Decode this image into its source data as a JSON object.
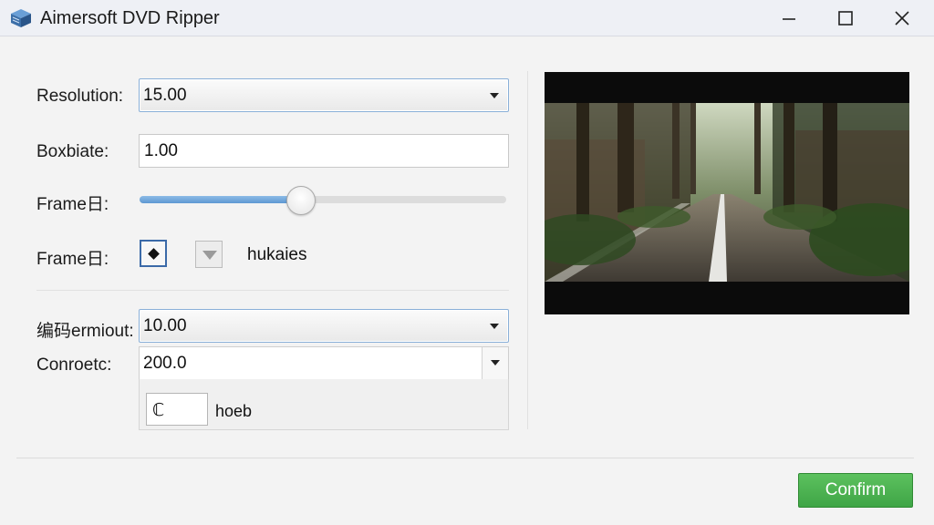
{
  "window": {
    "title": "Aimersoft DVD Ripper",
    "controls": [
      "minimize",
      "maximize",
      "close"
    ]
  },
  "settings": {
    "resolution": {
      "label": "Resolution:",
      "value": "15.00"
    },
    "bitrate": {
      "label": "Boxbiate:",
      "value": "1.00"
    },
    "frame_slider": {
      "label": "Frame日:",
      "level_percent": 44
    },
    "frame_toggle": {
      "label": "Frame日:",
      "option_text": "hukaies",
      "checked": true
    },
    "encoder": {
      "label": "编码ermiout:",
      "value": "10.00"
    },
    "connection": {
      "label": "Conroetc:",
      "value": "200.0"
    },
    "sub_option": {
      "input_value": "ℂ",
      "text": "hoeb"
    }
  },
  "preview": {
    "icon": "video-preview"
  },
  "actions": {
    "confirm_label": "Confirm"
  },
  "colors": {
    "accent": "#4a90d9",
    "confirm": "#45ad4a"
  }
}
